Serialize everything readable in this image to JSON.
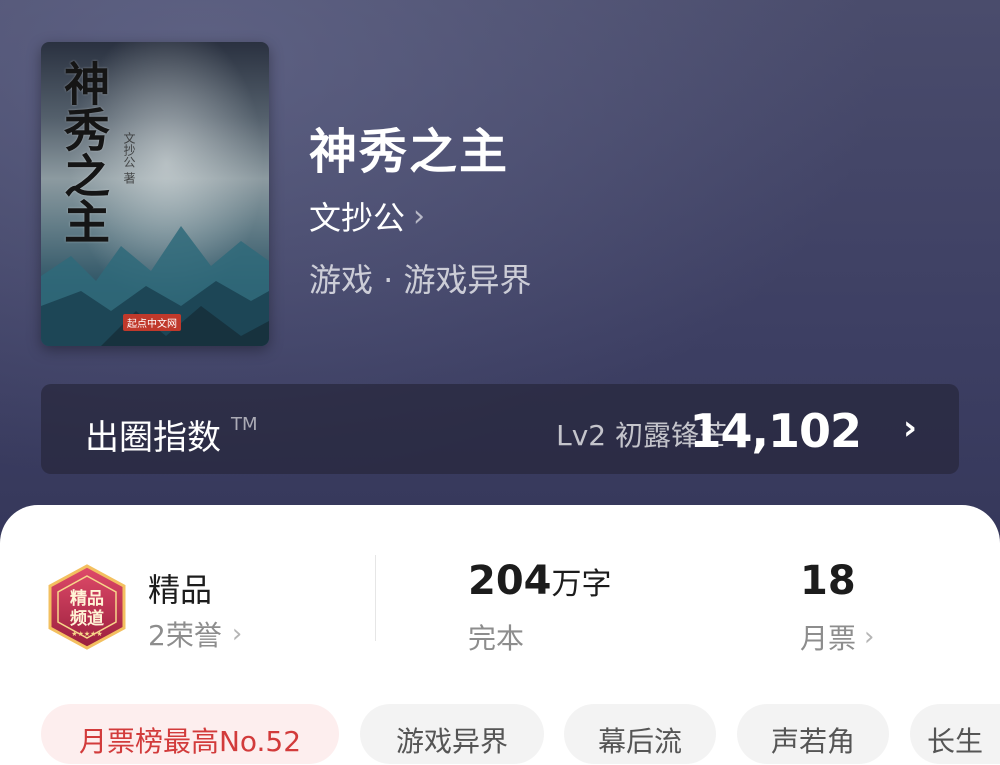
{
  "book": {
    "title": "神秀之主",
    "author": "文抄公",
    "genre": "游戏 · 游戏异界",
    "cover": {
      "title_text": "神秀之主",
      "author_text": "文抄公 著",
      "publisher_text": "起点中文网"
    }
  },
  "index": {
    "label": "出圈指数",
    "tm": "TM",
    "level": "Lv2 初露锋芒",
    "value": "14,102"
  },
  "stats": {
    "quality_title": "精品",
    "quality_sub": "2荣誉",
    "badge_text": "精品频道",
    "words_num": "204",
    "words_unit": "万字",
    "words_sub": "完本",
    "votes_num": "18",
    "votes_sub": "月票"
  },
  "tags": [
    "月票榜最高No.52",
    "游戏异界",
    "幕后流",
    "声若角",
    "长生"
  ],
  "colors": {
    "header_bg": "#3f4066",
    "card_bg": "#ffffff",
    "hot_tag_text": "#d23b3b",
    "badge_primary": "#b8274a"
  },
  "icons": {
    "author_chevron": "chevron-right-icon",
    "index_chevron": "chevron-right-icon",
    "badge": "premium-badge-icon"
  }
}
